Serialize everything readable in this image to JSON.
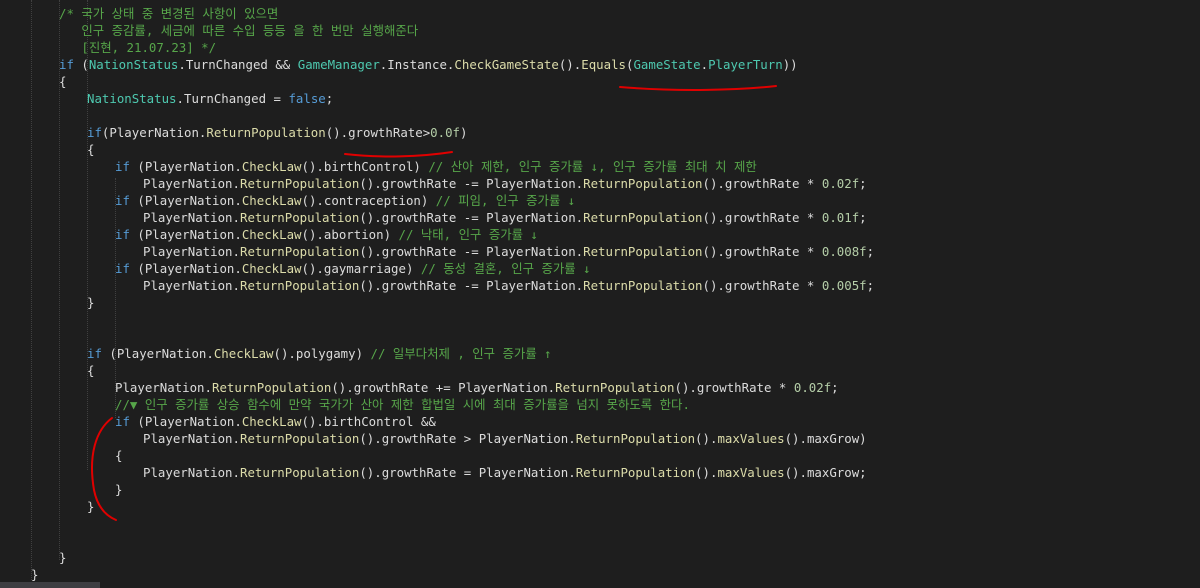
{
  "editor": {
    "language": "csharp",
    "line_height": 17,
    "char_width": 7.0,
    "left_margin": 31,
    "lines": [
      {
        "indent": 4,
        "tokens": [
          [
            "cm",
            "/* 국가 상태 중 변경된 사항이 있으면"
          ]
        ]
      },
      {
        "indent": 4,
        "tokens": [
          [
            "cm",
            "   인구 증감률, 세금에 따른 수입 등등 을 한 번만 실행해준다"
          ]
        ]
      },
      {
        "indent": 4,
        "tokens": [
          [
            "cm",
            "   [진현, 21.07.23] */"
          ]
        ]
      },
      {
        "indent": 4,
        "tokens": [
          [
            "kw",
            "if"
          ],
          [
            "pl",
            " ("
          ],
          [
            "ty",
            "NationStatus"
          ],
          [
            "pl",
            ".TurnChanged && "
          ],
          [
            "ty",
            "GameManager"
          ],
          [
            "pl",
            ".Instance."
          ],
          [
            "fn",
            "CheckGameState"
          ],
          [
            "pl",
            "()."
          ],
          [
            "fn",
            "Equals"
          ],
          [
            "pl",
            "("
          ],
          [
            "ty",
            "GameState"
          ],
          [
            "pl",
            "."
          ],
          [
            "ty",
            "PlayerTurn"
          ],
          [
            "pl",
            "))"
          ]
        ]
      },
      {
        "indent": 4,
        "tokens": [
          [
            "pl",
            "{"
          ]
        ]
      },
      {
        "indent": 8,
        "tokens": [
          [
            "ty",
            "NationStatus"
          ],
          [
            "pl",
            ".TurnChanged = "
          ],
          [
            "kw",
            "false"
          ],
          [
            "pl",
            ";"
          ]
        ]
      },
      {
        "indent": 0,
        "tokens": []
      },
      {
        "indent": 8,
        "tokens": [
          [
            "kw",
            "if"
          ],
          [
            "pl",
            "(PlayerNation."
          ],
          [
            "fn",
            "ReturnPopulation"
          ],
          [
            "pl",
            "().growthRate>"
          ],
          [
            "nu",
            "0.0f"
          ],
          [
            "pl",
            ")"
          ]
        ]
      },
      {
        "indent": 8,
        "tokens": [
          [
            "pl",
            "{"
          ]
        ]
      },
      {
        "indent": 12,
        "tokens": [
          [
            "kw",
            "if"
          ],
          [
            "pl",
            " (PlayerNation."
          ],
          [
            "fn",
            "CheckLaw"
          ],
          [
            "pl",
            "().birthControl) "
          ],
          [
            "cm",
            "// 산아 제한, 인구 증가률 ↓, 인구 증가률 최대 치 제한"
          ]
        ]
      },
      {
        "indent": 16,
        "tokens": [
          [
            "pl",
            "PlayerNation."
          ],
          [
            "fn",
            "ReturnPopulation"
          ],
          [
            "pl",
            "().growthRate -= PlayerNation."
          ],
          [
            "fn",
            "ReturnPopulation"
          ],
          [
            "pl",
            "().growthRate * "
          ],
          [
            "nu",
            "0.02f"
          ],
          [
            "pl",
            ";"
          ]
        ]
      },
      {
        "indent": 12,
        "tokens": [
          [
            "kw",
            "if"
          ],
          [
            "pl",
            " (PlayerNation."
          ],
          [
            "fn",
            "CheckLaw"
          ],
          [
            "pl",
            "().contraception) "
          ],
          [
            "cm",
            "// 피임, 인구 증가률 ↓"
          ]
        ]
      },
      {
        "indent": 16,
        "tokens": [
          [
            "pl",
            "PlayerNation."
          ],
          [
            "fn",
            "ReturnPopulation"
          ],
          [
            "pl",
            "().growthRate -= PlayerNation."
          ],
          [
            "fn",
            "ReturnPopulation"
          ],
          [
            "pl",
            "().growthRate * "
          ],
          [
            "nu",
            "0.01f"
          ],
          [
            "pl",
            ";"
          ]
        ]
      },
      {
        "indent": 12,
        "tokens": [
          [
            "kw",
            "if"
          ],
          [
            "pl",
            " (PlayerNation."
          ],
          [
            "fn",
            "CheckLaw"
          ],
          [
            "pl",
            "().abortion) "
          ],
          [
            "cm",
            "// 낙태, 인구 증가률 ↓"
          ]
        ]
      },
      {
        "indent": 16,
        "tokens": [
          [
            "pl",
            "PlayerNation."
          ],
          [
            "fn",
            "ReturnPopulation"
          ],
          [
            "pl",
            "().growthRate -= PlayerNation."
          ],
          [
            "fn",
            "ReturnPopulation"
          ],
          [
            "pl",
            "().growthRate * "
          ],
          [
            "nu",
            "0.008f"
          ],
          [
            "pl",
            ";"
          ]
        ]
      },
      {
        "indent": 12,
        "tokens": [
          [
            "kw",
            "if"
          ],
          [
            "pl",
            " (PlayerNation."
          ],
          [
            "fn",
            "CheckLaw"
          ],
          [
            "pl",
            "().gaymarriage) "
          ],
          [
            "cm",
            "// 동성 결혼, 인구 증가률 ↓"
          ]
        ]
      },
      {
        "indent": 16,
        "tokens": [
          [
            "pl",
            "PlayerNation."
          ],
          [
            "fn",
            "ReturnPopulation"
          ],
          [
            "pl",
            "().growthRate -= PlayerNation."
          ],
          [
            "fn",
            "ReturnPopulation"
          ],
          [
            "pl",
            "().growthRate * "
          ],
          [
            "nu",
            "0.005f"
          ],
          [
            "pl",
            ";"
          ]
        ]
      },
      {
        "indent": 8,
        "tokens": [
          [
            "pl",
            "}"
          ]
        ]
      },
      {
        "indent": 0,
        "tokens": []
      },
      {
        "indent": 0,
        "tokens": []
      },
      {
        "indent": 8,
        "tokens": [
          [
            "kw",
            "if"
          ],
          [
            "pl",
            " (PlayerNation."
          ],
          [
            "fn",
            "CheckLaw"
          ],
          [
            "pl",
            "().polygamy) "
          ],
          [
            "cm",
            "// 일부다처제 , 인구 증가률 ↑"
          ]
        ]
      },
      {
        "indent": 8,
        "tokens": [
          [
            "pl",
            "{"
          ]
        ]
      },
      {
        "indent": 12,
        "tokens": [
          [
            "pl",
            "PlayerNation."
          ],
          [
            "fn",
            "ReturnPopulation"
          ],
          [
            "pl",
            "().growthRate += PlayerNation."
          ],
          [
            "fn",
            "ReturnPopulation"
          ],
          [
            "pl",
            "().growthRate * "
          ],
          [
            "nu",
            "0.02f"
          ],
          [
            "pl",
            ";"
          ]
        ]
      },
      {
        "indent": 12,
        "tokens": [
          [
            "cm",
            "//▼ 인구 증가률 상승 함수에 만약 국가가 산아 제한 합법일 시에 최대 증가률을 넘지 못하도록 한다."
          ]
        ]
      },
      {
        "indent": 12,
        "tokens": [
          [
            "kw",
            "if"
          ],
          [
            "pl",
            " (PlayerNation."
          ],
          [
            "fn",
            "CheckLaw"
          ],
          [
            "pl",
            "().birthControl &&"
          ]
        ]
      },
      {
        "indent": 16,
        "tokens": [
          [
            "pl",
            "PlayerNation."
          ],
          [
            "fn",
            "ReturnPopulation"
          ],
          [
            "pl",
            "().growthRate > PlayerNation."
          ],
          [
            "fn",
            "ReturnPopulation"
          ],
          [
            "pl",
            "()."
          ],
          [
            "fn",
            "maxValues"
          ],
          [
            "pl",
            "().maxGrow)"
          ]
        ]
      },
      {
        "indent": 12,
        "tokens": [
          [
            "pl",
            "{"
          ]
        ]
      },
      {
        "indent": 16,
        "tokens": [
          [
            "pl",
            "PlayerNation."
          ],
          [
            "fn",
            "ReturnPopulation"
          ],
          [
            "pl",
            "().growthRate = PlayerNation."
          ],
          [
            "fn",
            "ReturnPopulation"
          ],
          [
            "pl",
            "()."
          ],
          [
            "fn",
            "maxValues"
          ],
          [
            "pl",
            "().maxGrow;"
          ]
        ]
      },
      {
        "indent": 12,
        "tokens": [
          [
            "pl",
            "}"
          ]
        ]
      },
      {
        "indent": 8,
        "tokens": [
          [
            "pl",
            "}"
          ]
        ]
      },
      {
        "indent": 0,
        "tokens": []
      },
      {
        "indent": 0,
        "tokens": []
      },
      {
        "indent": 4,
        "tokens": [
          [
            "pl",
            "}"
          ]
        ]
      },
      {
        "indent": 0,
        "tokens": [
          [
            "pl",
            "}"
          ]
        ]
      }
    ]
  },
  "colors": {
    "background": "#1e1e1e",
    "keyword": "#569cd6",
    "type": "#4ec9b0",
    "method": "#dcdcaa",
    "comment": "#57a64a",
    "number": "#b5cea8",
    "plain": "#dcdcdc",
    "annotation_ink": "#e00000"
  }
}
